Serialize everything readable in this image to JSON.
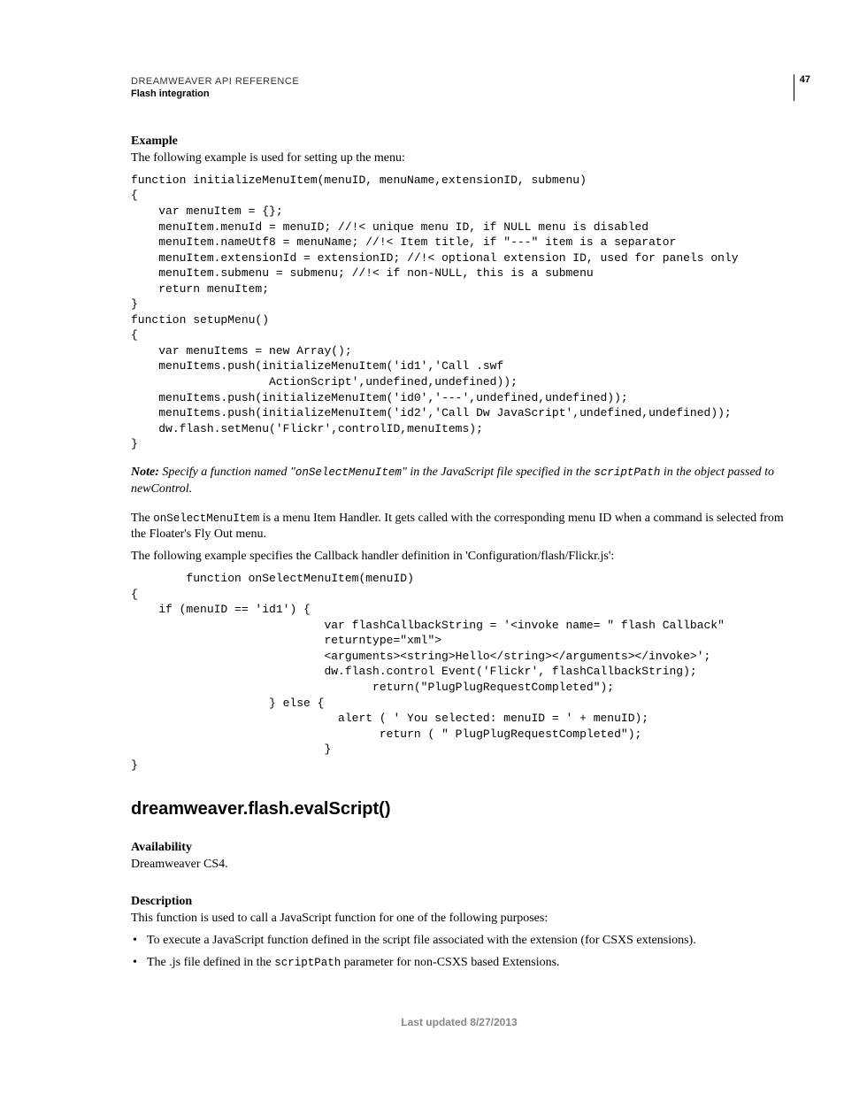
{
  "header": {
    "reference": "DREAMWEAVER API REFERENCE",
    "section": "Flash integration",
    "page_number": "47"
  },
  "sections": {
    "example": {
      "heading": "Example",
      "intro": "The following example is used for setting up the menu:",
      "code1": "function initializeMenuItem(menuID, menuName,extensionID, submenu) \n{ \n    var menuItem = {}; \n    menuItem.menuId = menuID; //!< unique menu ID, if NULL menu is disabled \n    menuItem.nameUtf8 = menuName; //!< Item title, if \"---\" item is a separator \n    menuItem.extensionId = extensionID; //!< optional extension ID, used for panels only \n    menuItem.submenu = submenu; //!< if non-NULL, this is a submenu \n    return menuItem; \n} \nfunction setupMenu() \n{ \n    var menuItems = new Array(); \n    menuItems.push(initializeMenuItem('id1','Call .swf \n                    ActionScript',undefined,undefined)); \n    menuItems.push(initializeMenuItem('id0','---',undefined,undefined)); \n    menuItems.push(initializeMenuItem('id2','Call Dw JavaScript',undefined,undefined)); \n    dw.flash.setMenu('Flickr',controlID,menuItems); \n}"
    },
    "note": {
      "label": "Note:",
      "pre": " Specify a function named \"",
      "code1": "onSelectMenuItem",
      "mid": "\" in the JavaScript file specified in the ",
      "code2": "scriptPath",
      "post": " in the object passed to newControl."
    },
    "para1": {
      "pre": "The ",
      "code": "onSelectMenuItem",
      "post": " is a menu Item Handler. It gets called with the corresponding menu ID when a command is selected from the Floater's Fly Out menu."
    },
    "para2": "The following example specifies the Callback handler definition in 'Configuration/flash/Flickr.js':",
    "code2": "        function onSelectMenuItem(menuID) \n{ \n    if (menuID == 'id1') { \n                            var flashCallbackString = '<invoke name= \" flash Callback\" \n                            returntype=\"xml\"> \n                            <arguments><string>Hello</string></arguments></invoke>'; \n                            dw.flash.control Event('Flickr', flashCallbackString); \n                                   return(\"PlugPlugRequestCompleted\"); \n                    } else { \n                              alert ( ' You selected: menuID = ' + menuID); \n                                    return ( \" PlugPlugRequestCompleted\"); \n                            } \n}"
  },
  "api": {
    "heading": "dreamweaver.flash.evalScript()",
    "availability_h": "Availability",
    "availability_t": "Dreamweaver CS4.",
    "description_h": "Description",
    "description_t": "This function is used to call a JavaScript function for one of the following purposes:",
    "bullets": [
      "To execute a JavaScript function defined in the script file associated with the extension (for CSXS extensions).",
      "The .js file defined in the "
    ],
    "bullet2_code": "scriptPath",
    "bullet2_post": " parameter for non-CSXS based Extensions."
  },
  "footer": "Last updated 8/27/2013"
}
